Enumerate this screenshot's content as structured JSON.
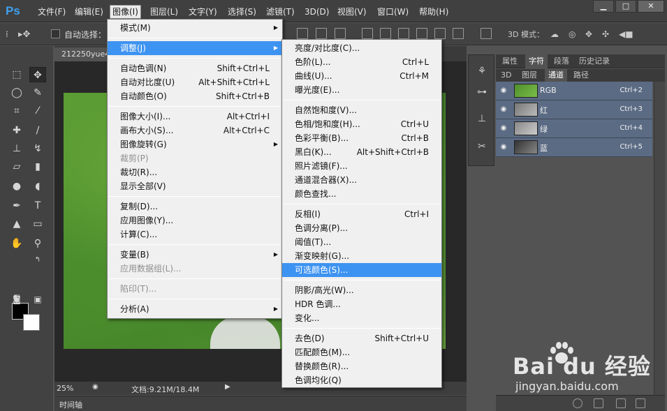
{
  "app": {
    "logo": "Ps"
  },
  "menubar": {
    "items": [
      "文件(F)",
      "编辑(E)",
      "图像(I)",
      "图层(L)",
      "文字(Y)",
      "选择(S)",
      "滤镜(T)",
      "3D(D)",
      "视图(V)",
      "窗口(W)",
      "帮助(H)"
    ],
    "active": "图像(I)"
  },
  "window_controls": {
    "minimize": "▁",
    "maximize": "□",
    "close": "✕"
  },
  "options_bar": {
    "auto_select_label": "自动选择：",
    "mode_3d_label": "3D 模式："
  },
  "document": {
    "tab_title": "212250yue4",
    "zoom": "25%",
    "doc_info": "文档:9.21M/18.4M",
    "timeline_label": "时间轴"
  },
  "panels": {
    "top_tabs": [
      "属性",
      "字符",
      "段落",
      "历史记录"
    ],
    "top_active": "字符",
    "sub_tabs": [
      "3D",
      "图层",
      "通道",
      "路径"
    ],
    "sub_active": "通道",
    "channels": [
      {
        "name": "RGB",
        "shortcut": "Ctrl+2"
      },
      {
        "name": "红",
        "shortcut": "Ctrl+3"
      },
      {
        "name": "绿",
        "shortcut": "Ctrl+4"
      },
      {
        "name": "蓝",
        "shortcut": "Ctrl+5"
      }
    ]
  },
  "image_menu": [
    {
      "label": "模式(M)",
      "submenu": true
    },
    {
      "sep": true
    },
    {
      "label": "调整(J)",
      "submenu": true,
      "highlighted": true
    },
    {
      "sep": true
    },
    {
      "label": "自动色调(N)",
      "shortcut": "Shift+Ctrl+L"
    },
    {
      "label": "自动对比度(U)",
      "shortcut": "Alt+Shift+Ctrl+L"
    },
    {
      "label": "自动颜色(O)",
      "shortcut": "Shift+Ctrl+B"
    },
    {
      "sep": true
    },
    {
      "label": "图像大小(I)...",
      "shortcut": "Alt+Ctrl+I"
    },
    {
      "label": "画布大小(S)...",
      "shortcut": "Alt+Ctrl+C"
    },
    {
      "label": "图像旋转(G)",
      "submenu": true
    },
    {
      "label": "裁剪(P)",
      "disabled": true
    },
    {
      "label": "裁切(R)..."
    },
    {
      "label": "显示全部(V)"
    },
    {
      "sep": true
    },
    {
      "label": "复制(D)..."
    },
    {
      "label": "应用图像(Y)..."
    },
    {
      "label": "计算(C)..."
    },
    {
      "sep": true
    },
    {
      "label": "变量(B)",
      "submenu": true
    },
    {
      "label": "应用数据组(L)...",
      "disabled": true
    },
    {
      "sep": true
    },
    {
      "label": "陷印(T)...",
      "disabled": true
    },
    {
      "sep": true
    },
    {
      "label": "分析(A)",
      "submenu": true
    }
  ],
  "adjust_menu": [
    {
      "label": "亮度/对比度(C)..."
    },
    {
      "label": "色阶(L)...",
      "shortcut": "Ctrl+L"
    },
    {
      "label": "曲线(U)...",
      "shortcut": "Ctrl+M"
    },
    {
      "label": "曝光度(E)..."
    },
    {
      "sep": true
    },
    {
      "label": "自然饱和度(V)..."
    },
    {
      "label": "色相/饱和度(H)...",
      "shortcut": "Ctrl+U"
    },
    {
      "label": "色彩平衡(B)...",
      "shortcut": "Ctrl+B"
    },
    {
      "label": "黑白(K)...",
      "shortcut": "Alt+Shift+Ctrl+B"
    },
    {
      "label": "照片滤镜(F)..."
    },
    {
      "label": "通道混合器(X)..."
    },
    {
      "label": "颜色查找..."
    },
    {
      "sep": true
    },
    {
      "label": "反相(I)",
      "shortcut": "Ctrl+I"
    },
    {
      "label": "色调分离(P)..."
    },
    {
      "label": "阈值(T)..."
    },
    {
      "label": "渐变映射(G)..."
    },
    {
      "label": "可选颜色(S)...",
      "highlighted": true
    },
    {
      "sep": true
    },
    {
      "label": "阴影/高光(W)..."
    },
    {
      "label": "HDR 色调..."
    },
    {
      "label": "变化..."
    },
    {
      "sep": true
    },
    {
      "label": "去色(D)",
      "shortcut": "Shift+Ctrl+U"
    },
    {
      "label": "匹配颜色(M)..."
    },
    {
      "label": "替换颜色(R)..."
    },
    {
      "label": "色调均化(Q)"
    }
  ],
  "watermark": {
    "logo_text": "Bai  du 经验",
    "url": "jingyan.baidu.com"
  },
  "colors": {
    "highlight": "#3d93f1",
    "ps_blue": "#3fa1f0",
    "channel_row": "#5b6b84"
  }
}
